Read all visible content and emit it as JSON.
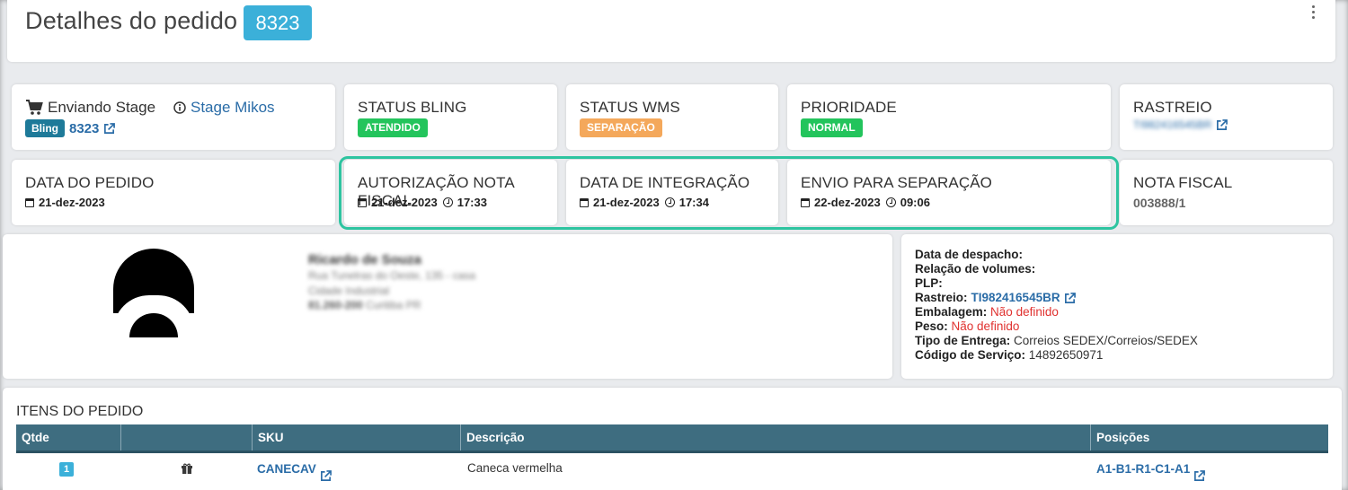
{
  "header": {
    "title": "Detalhes do pedido",
    "order_number": "8323"
  },
  "row1": {
    "stage": {
      "label": "Enviando Stage",
      "info_link": "Stage Mikos",
      "source_badge": "Bling",
      "source_id": "8323"
    },
    "status_bling": {
      "label": "STATUS BLING",
      "value": "ATENDIDO",
      "color": "#23c45c"
    },
    "status_wms": {
      "label": "STATUS WMS",
      "value": "SEPARAÇÃO",
      "color": "#f4a85b"
    },
    "prioridade": {
      "label": "PRIORIDADE",
      "value": "NORMAL",
      "color": "#23c45c"
    },
    "rastreio": {
      "label": "RASTREIO",
      "value": "TI982416545BR"
    }
  },
  "row2": {
    "data_pedido": {
      "label": "DATA DO PEDIDO",
      "date": "21-dez-2023"
    },
    "autorizacao": {
      "label": "AUTORIZAÇÃO NOTA FISCAL",
      "date": "21-dez-2023",
      "time": "17:33"
    },
    "integracao": {
      "label": "DATA DE INTEGRAÇÃO",
      "date": "21-dez-2023",
      "time": "17:34"
    },
    "envio": {
      "label": "ENVIO PARA SEPARAÇÃO",
      "date": "22-dez-2023",
      "time": "09:06"
    },
    "nota_fiscal": {
      "label": "NOTA FISCAL",
      "value": "003888/1"
    }
  },
  "customer": {
    "name": "Ricardo de Souza",
    "address": "Rua Tunelras do Oeste, 135 - casa",
    "district": "Cidade Industrial",
    "cep": "81.260-200",
    "city": "Curitiba PR"
  },
  "shipping": {
    "data_despacho_label": "Data de despacho:",
    "relacao_label": "Relação de volumes:",
    "plp_label": "PLP:",
    "rastreio_label": "Rastreio:",
    "rastreio_value": "TI982416545BR",
    "embalagem_label": "Embalagem:",
    "embalagem_value": "Não definido",
    "peso_label": "Peso:",
    "peso_value": "Não definido",
    "tipo_label": "Tipo de Entrega:",
    "tipo_value": "Correios SEDEX/Correios/SEDEX",
    "codigo_label": "Código de Serviço:",
    "codigo_value": "14892650971"
  },
  "items": {
    "title": "ITENS DO PEDIDO",
    "columns": [
      "Qtde",
      "",
      "SKU",
      "Descrição",
      "Posições"
    ],
    "rows": [
      {
        "qty": "1",
        "sku": "CANECAV",
        "description": "Caneca vermelha",
        "positions": "A1-B1-R1-C1-A1"
      }
    ]
  }
}
